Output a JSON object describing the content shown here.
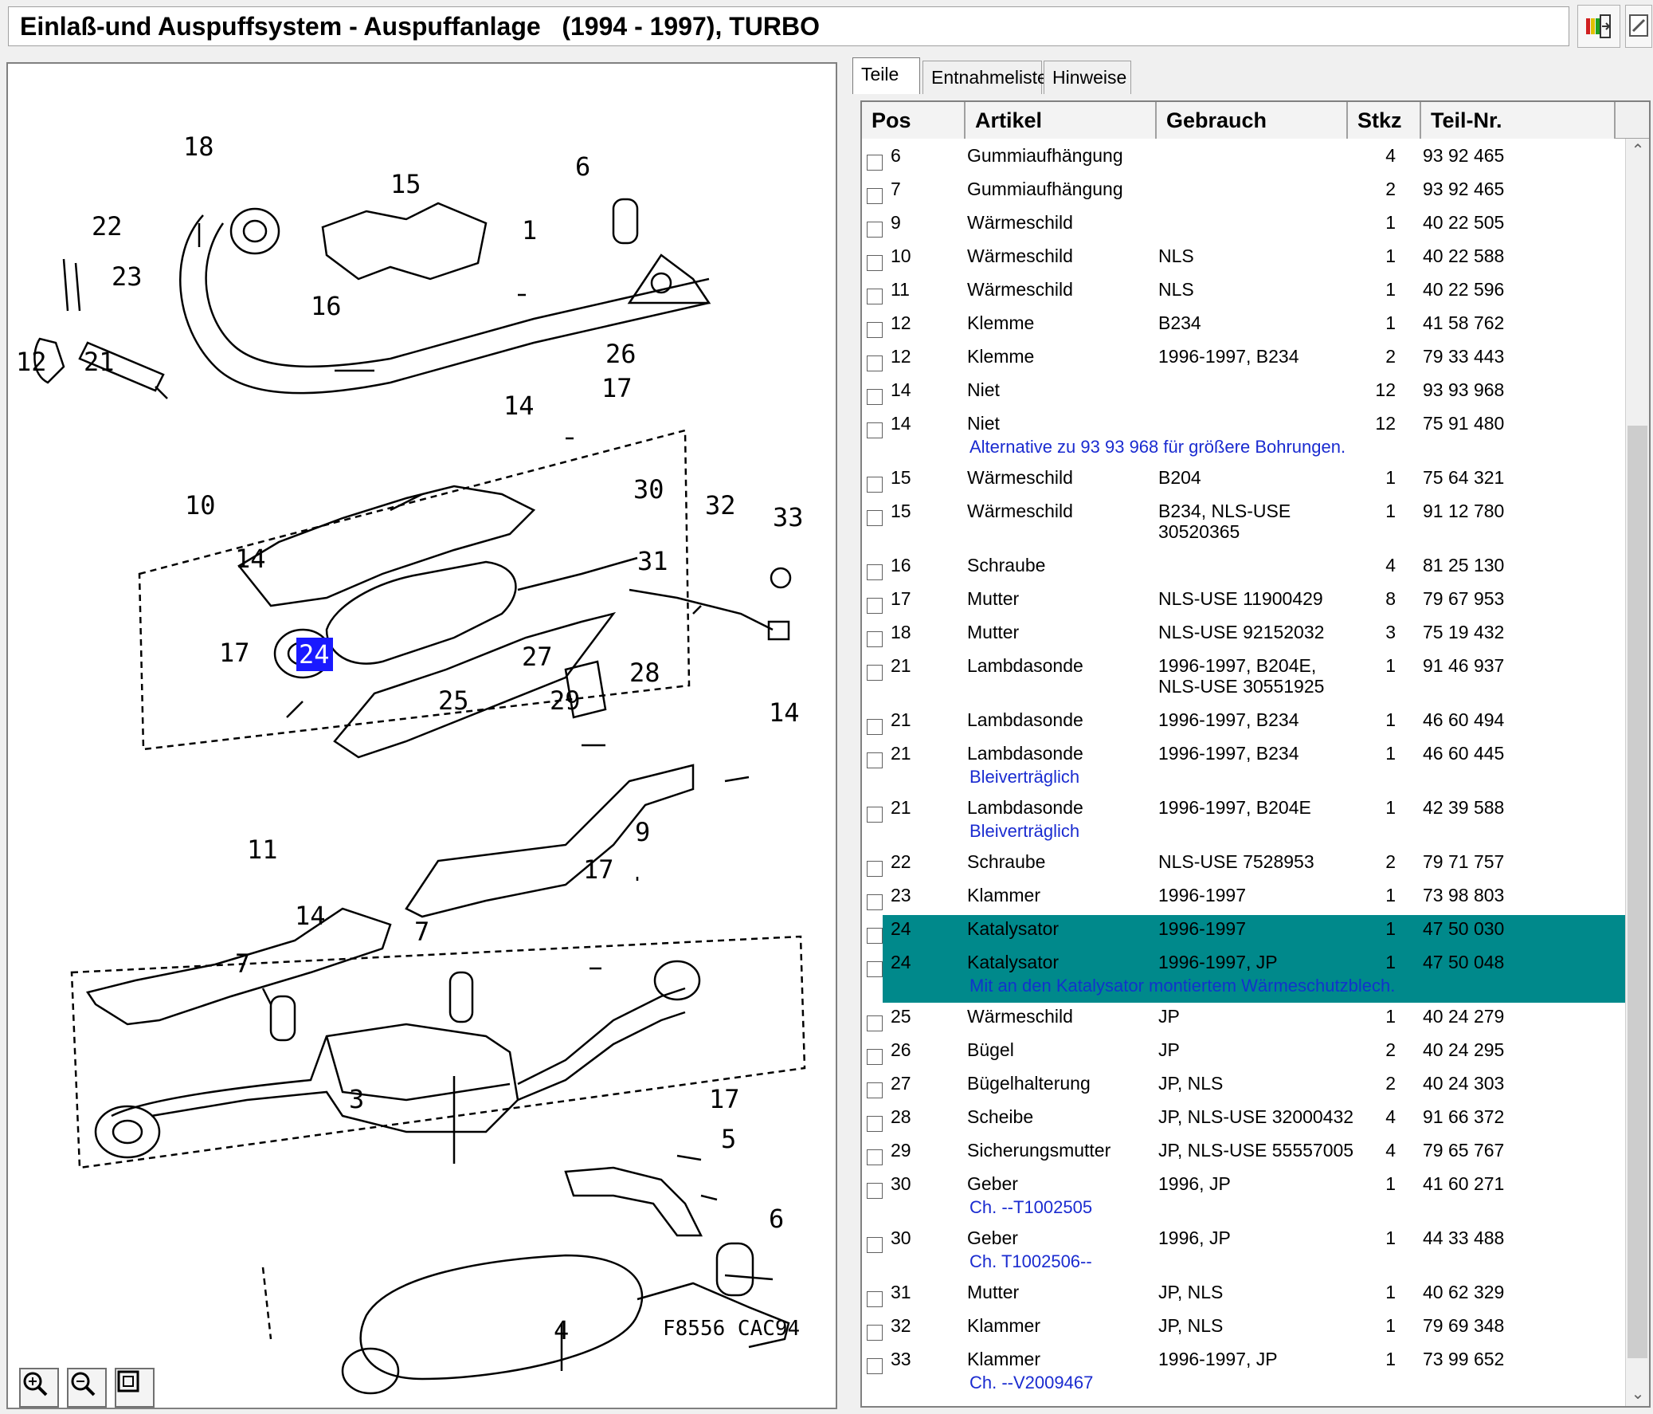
{
  "title": "Einlaß-und Auspuffsystem - Auspuffanlage   (1994 - 1997), TURBO",
  "tabs": [
    "Teile",
    "Entnahmeliste",
    "Hinweise"
  ],
  "columns": [
    "Pos",
    "Artikel",
    "Gebrauch",
    "Stkz",
    "Teil-Nr."
  ],
  "rows": [
    {
      "pos": "6",
      "artikel": "Gummiaufhängung",
      "gebrauch": "",
      "stkz": "4",
      "teil": "93 92 465",
      "note": ""
    },
    {
      "pos": "7",
      "artikel": "Gummiaufhängung",
      "gebrauch": "",
      "stkz": "2",
      "teil": "93 92 465",
      "note": ""
    },
    {
      "pos": "9",
      "artikel": "Wärmeschild",
      "gebrauch": "",
      "stkz": "1",
      "teil": "40 22 505",
      "note": ""
    },
    {
      "pos": "10",
      "artikel": "Wärmeschild",
      "gebrauch": "NLS",
      "stkz": "1",
      "teil": "40 22 588",
      "note": ""
    },
    {
      "pos": "11",
      "artikel": "Wärmeschild",
      "gebrauch": "NLS",
      "stkz": "1",
      "teil": "40 22 596",
      "note": ""
    },
    {
      "pos": "12",
      "artikel": "Klemme",
      "gebrauch": "B234",
      "stkz": "1",
      "teil": "41 58 762",
      "note": ""
    },
    {
      "pos": "12",
      "artikel": "Klemme",
      "gebrauch": "1996-1997, B234",
      "stkz": "2",
      "teil": "79 33 443",
      "note": ""
    },
    {
      "pos": "14",
      "artikel": "Niet",
      "gebrauch": "",
      "stkz": "12",
      "teil": "93 93 968",
      "note": ""
    },
    {
      "pos": "14",
      "artikel": "Niet",
      "gebrauch": "",
      "stkz": "12",
      "teil": "75 91 480",
      "note": "Alternative zu 93 93 968 für größere Bohrungen."
    },
    {
      "pos": "15",
      "artikel": "Wärmeschild",
      "gebrauch": "B204",
      "stkz": "1",
      "teil": "75 64 321",
      "note": ""
    },
    {
      "pos": "15",
      "artikel": "Wärmeschild",
      "gebrauch": "B234, NLS-USE",
      "gebrauch2": "30520365",
      "stkz": "1",
      "teil": "91 12 780",
      "note": ""
    },
    {
      "pos": "16",
      "artikel": "Schraube",
      "gebrauch": "",
      "stkz": "4",
      "teil": "81 25 130",
      "note": ""
    },
    {
      "pos": "17",
      "artikel": "Mutter",
      "gebrauch": "NLS-USE 11900429",
      "stkz": "8",
      "teil": "79 67 953",
      "note": ""
    },
    {
      "pos": "18",
      "artikel": "Mutter",
      "gebrauch": "NLS-USE 92152032",
      "stkz": "3",
      "teil": "75 19 432",
      "note": ""
    },
    {
      "pos": "21",
      "artikel": "Lambdasonde",
      "gebrauch": "1996-1997, B204E,",
      "gebrauch2": "NLS-USE 30551925",
      "stkz": "1",
      "teil": "91 46 937",
      "note": ""
    },
    {
      "pos": "21",
      "artikel": "Lambdasonde",
      "gebrauch": "1996-1997, B234",
      "stkz": "1",
      "teil": "46 60 494",
      "note": ""
    },
    {
      "pos": "21",
      "artikel": "Lambdasonde",
      "gebrauch": "1996-1997, B234",
      "stkz": "1",
      "teil": "46 60 445",
      "note": "Bleiverträglich"
    },
    {
      "pos": "21",
      "artikel": "Lambdasonde",
      "gebrauch": "1996-1997, B204E",
      "stkz": "1",
      "teil": "42 39 588",
      "note": "Bleiverträglich"
    },
    {
      "pos": "22",
      "artikel": "Schraube",
      "gebrauch": "NLS-USE 7528953",
      "stkz": "2",
      "teil": "79 71 757",
      "note": ""
    },
    {
      "pos": "23",
      "artikel": "Klammer",
      "gebrauch": "1996-1997",
      "stkz": "1",
      "teil": "73 98 803",
      "note": ""
    },
    {
      "pos": "24",
      "artikel": "Katalysator",
      "gebrauch": "1996-1997",
      "stkz": "1",
      "teil": "47 50 030",
      "note": "",
      "selected": true
    },
    {
      "pos": "24",
      "artikel": "Katalysator",
      "gebrauch": "1996-1997, JP",
      "stkz": "1",
      "teil": "47 50 048",
      "note": "Mit an den Katalysator montiertem Wärmeschutzblech.",
      "selected": true
    },
    {
      "pos": "25",
      "artikel": "Wärmeschild",
      "gebrauch": "JP",
      "stkz": "1",
      "teil": "40 24 279",
      "note": ""
    },
    {
      "pos": "26",
      "artikel": "Bügel",
      "gebrauch": "JP",
      "stkz": "2",
      "teil": "40 24 295",
      "note": ""
    },
    {
      "pos": "27",
      "artikel": "Bügelhalterung",
      "gebrauch": "JP, NLS",
      "stkz": "2",
      "teil": "40 24 303",
      "note": ""
    },
    {
      "pos": "28",
      "artikel": "Scheibe",
      "gebrauch": "JP, NLS-USE 32000432",
      "stkz": "4",
      "teil": "91 66 372",
      "note": ""
    },
    {
      "pos": "29",
      "artikel": "Sicherungsmutter",
      "gebrauch": "JP, NLS-USE 55557005",
      "stkz": "4",
      "teil": "79 65 767",
      "note": ""
    },
    {
      "pos": "30",
      "artikel": "Geber",
      "gebrauch": "1996, JP",
      "stkz": "1",
      "teil": "41 60 271",
      "note": "Ch. --T1002505"
    },
    {
      "pos": "30",
      "artikel": "Geber",
      "gebrauch": "1996, JP",
      "stkz": "1",
      "teil": "44 33 488",
      "note": "Ch. T1002506--"
    },
    {
      "pos": "31",
      "artikel": "Mutter",
      "gebrauch": "JP, NLS",
      "stkz": "1",
      "teil": "40 62 329",
      "note": ""
    },
    {
      "pos": "32",
      "artikel": "Klammer",
      "gebrauch": "JP, NLS",
      "stkz": "1",
      "teil": "79 69 348",
      "note": ""
    },
    {
      "pos": "33",
      "artikel": "Klammer",
      "gebrauch": "1996-1997, JP",
      "stkz": "1",
      "teil": "73 99 652",
      "note": "Ch. --V2009467"
    }
  ],
  "diagram": {
    "code": "F8556 CAC94",
    "highlight_label": "24",
    "labels": [
      "18",
      "15",
      "6",
      "1",
      "22",
      "23",
      "16",
      "12",
      "21",
      "26",
      "17",
      "14",
      "10",
      "30",
      "32",
      "33",
      "14",
      "31",
      "17",
      "27",
      "28",
      "25",
      "29",
      "14",
      "9",
      "11",
      "17",
      "14",
      "7",
      "7",
      "3",
      "17",
      "5",
      "6",
      "4"
    ]
  },
  "colors": {
    "selected_row": "#00898b",
    "note_text": "#1a2bd0",
    "highlight_label": "#1a1aff"
  },
  "icons": [
    "exit-icon",
    "edit-icon",
    "zoom-in-icon",
    "zoom-out-icon",
    "fit-page-icon",
    "scroll-up-icon",
    "scroll-down-icon"
  ]
}
